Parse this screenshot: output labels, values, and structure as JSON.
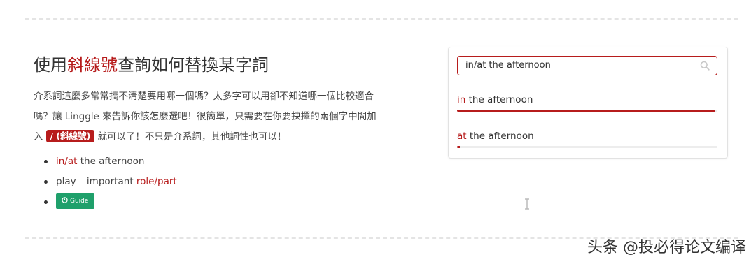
{
  "section": {
    "title_pre": "使用",
    "title_highlight": "斜線號",
    "title_post": "查詢如何替換某字詞",
    "desc_part1": "介系詞這麼多常常搞不清楚要用哪一個嗎？太多字可以用卻不知道哪一個比較適合嗎？讓 Linggle 來告訴你該怎麼選吧！很簡單，只需要在你要抉擇的兩個字中間加入",
    "slash_badge": "/ (斜線號)",
    "desc_part2": "就可以了！不只是介系詞，其他詞性也可以！",
    "examples": [
      {
        "highlight": "in/at",
        "rest": " the afternoon"
      },
      {
        "plain": "play _ important ",
        "highlight": "role/part"
      }
    ],
    "guide_button": "Guide"
  },
  "demo": {
    "query": "in/at the afternoon",
    "results": [
      {
        "word": "in",
        "rest": " the afternoon",
        "share": 0.99
      },
      {
        "word": "at",
        "rest": " the afternoon",
        "share": 0.01
      }
    ]
  },
  "watermark": "头条 @投必得论文编译",
  "colors": {
    "accent": "#b71c1c",
    "guide_green": "#1fa06b",
    "divider": "#e4e4e4"
  },
  "icons": {
    "search": "search-icon",
    "guide": "clock-icon",
    "cursor": "text-cursor-icon"
  }
}
